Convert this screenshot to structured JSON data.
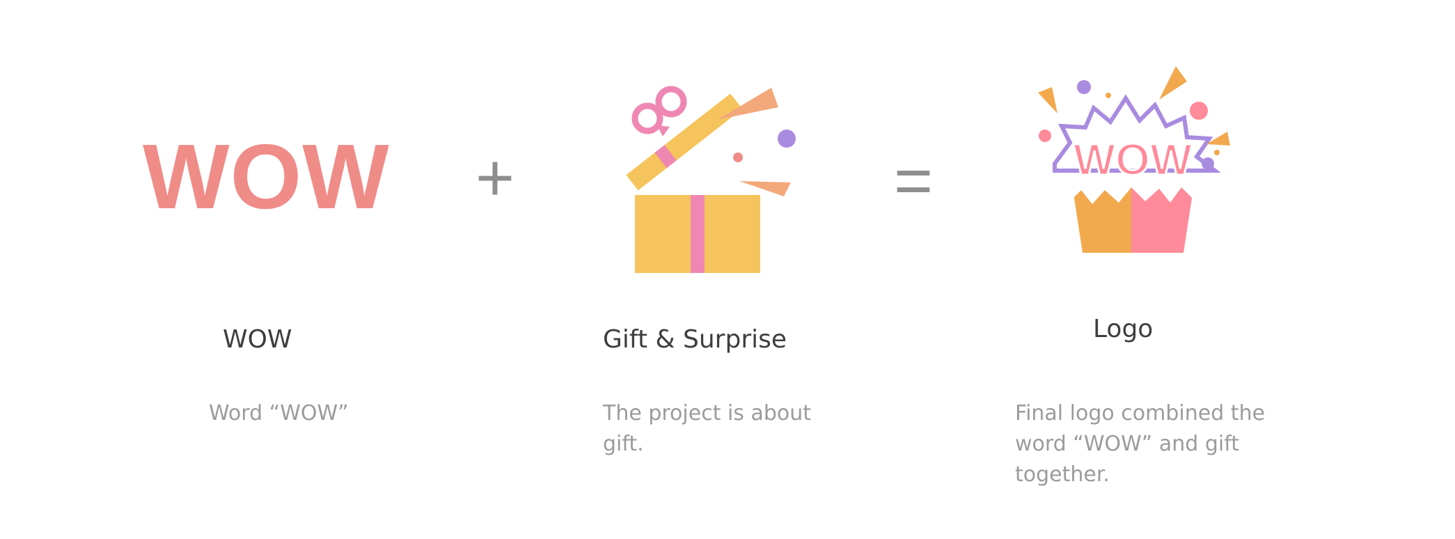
{
  "items": [
    {
      "graphic_text": "WOW",
      "title": "WOW",
      "description": "Word “WOW”"
    },
    {
      "graphic_icon": "gift-box-icon",
      "title": "Gift & Surprise",
      "description": "The project is about gift."
    },
    {
      "graphic_icon": "wow-gift-logo-icon",
      "logo_text": "WOW",
      "title": "Logo",
      "description": "Final logo combined the word “WOW” and gift together."
    }
  ],
  "operators": {
    "plus": "+",
    "equals": "="
  },
  "colors": {
    "wow_pink": "#ef8c88",
    "gift_yellow": "#f6c45c",
    "ribbon_pink": "#ef87b3",
    "logo_orange": "#f2a94e",
    "logo_pink": "#ff8a99",
    "confetti_purple": "#a98be0",
    "title_text": "#3e3e3e",
    "desc_text": "#9b9b9b",
    "operator": "#8e8e8e"
  }
}
